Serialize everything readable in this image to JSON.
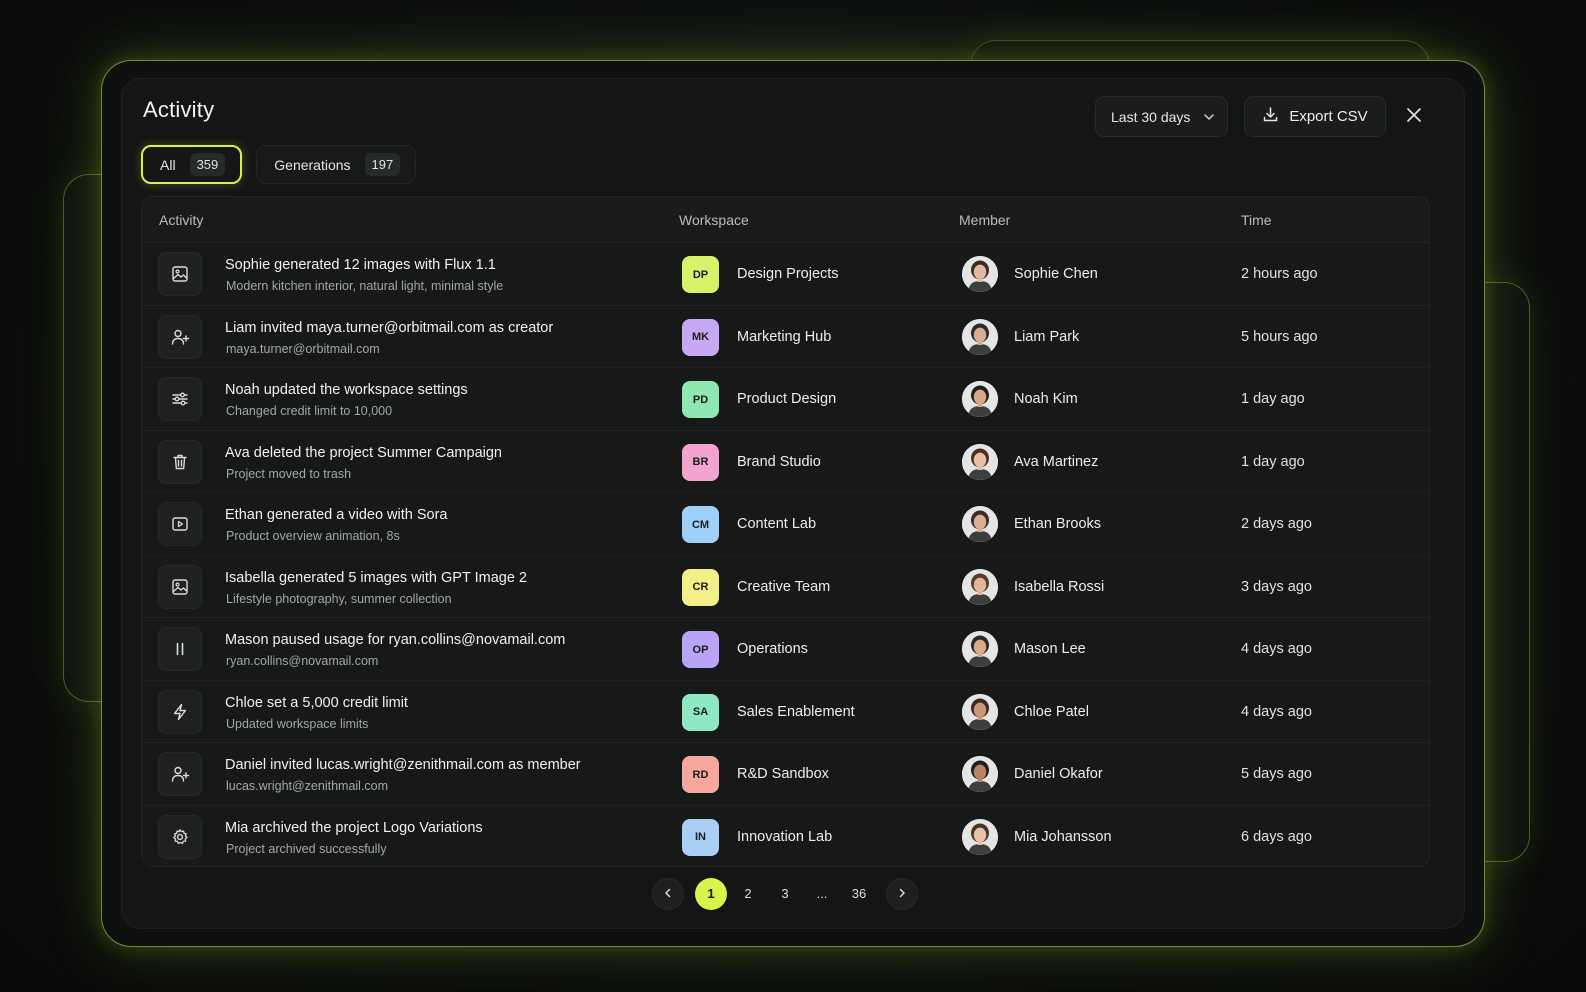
{
  "header": {
    "title": "Activity",
    "range_label": "Last 30 days",
    "export_label": "Export CSV"
  },
  "tabs": [
    {
      "label": "All",
      "count": "359",
      "active": true
    },
    {
      "label": "Generations",
      "count": "197",
      "active": false
    }
  ],
  "table": {
    "columns": [
      "Activity",
      "Workspace",
      "Member",
      "Time"
    ],
    "rows": [
      {
        "icon": "image-icon",
        "title": "Sophie generated 12 images with Flux 1.1",
        "subtitle": "Modern kitchen interior, natural light, minimal style",
        "ws_code": "DP",
        "ws_name": "Design Projects",
        "ws_color": "#d8f26a",
        "member": "Sophie Chen",
        "time": "2 hours ago"
      },
      {
        "icon": "user-plus-icon",
        "title": "Liam invited maya.turner@orbitmail.com as creator",
        "subtitle": "maya.turner@orbitmail.com",
        "ws_code": "MK",
        "ws_name": "Marketing Hub",
        "ws_color": "#c7a8f5",
        "member": "Liam Park",
        "time": "5 hours ago"
      },
      {
        "icon": "sliders-icon",
        "title": "Noah updated the workspace settings",
        "subtitle": "Changed credit limit to 10,000",
        "ws_code": "PD",
        "ws_name": "Product Design",
        "ws_color": "#8fe8b1",
        "member": "Noah Kim",
        "time": "1 day ago"
      },
      {
        "icon": "trash-icon",
        "title": "Ava deleted the project Summer Campaign",
        "subtitle": "Project moved to trash",
        "ws_code": "BR",
        "ws_name": "Brand Studio",
        "ws_color": "#f2a3cf",
        "member": "Ava Martinez",
        "time": "1 day ago"
      },
      {
        "icon": "video-icon",
        "title": "Ethan generated a video with Sora",
        "subtitle": "Product overview animation, 8s",
        "ws_code": "CM",
        "ws_name": "Content Lab",
        "ws_color": "#9fd0f7",
        "member": "Ethan Brooks",
        "time": "2 days ago"
      },
      {
        "icon": "image-icon",
        "title": "Isabella generated 5 images with GPT Image 2",
        "subtitle": "Lifestyle photography, summer collection",
        "ws_code": "CR",
        "ws_name": "Creative Team",
        "ws_color": "#f3f08a",
        "member": "Isabella Rossi",
        "time": "3 days ago"
      },
      {
        "icon": "pause-icon",
        "title": "Mason paused usage for ryan.collins@novamail.com",
        "subtitle": "ryan.collins@novamail.com",
        "ws_code": "OP",
        "ws_name": "Operations",
        "ws_color": "#b9a4f6",
        "member": "Mason Lee",
        "time": "4 days ago"
      },
      {
        "icon": "bolt-icon",
        "title": "Chloe set a 5,000 credit limit",
        "subtitle": "Updated workspace limits",
        "ws_code": "SA",
        "ws_name": "Sales Enablement",
        "ws_color": "#8fe8c4",
        "member": "Chloe Patel",
        "time": "4 days ago"
      },
      {
        "icon": "user-plus-icon",
        "title": "Daniel invited lucas.wright@zenithmail.com as member",
        "subtitle": "lucas.wright@zenithmail.com",
        "ws_code": "RD",
        "ws_name": "R&D Sandbox",
        "ws_color": "#f5a79b",
        "member": "Daniel Okafor",
        "time": "5 days ago"
      },
      {
        "icon": "gear-icon",
        "title": "Mia archived the project Logo Variations",
        "subtitle": "Project archived successfully",
        "ws_code": "IN",
        "ws_name": "Innovation Lab",
        "ws_color": "#a9cff6",
        "member": "Mia Johansson",
        "time": "6 days ago"
      }
    ]
  },
  "pagination": {
    "pages": [
      "1",
      "2",
      "3",
      "...",
      "36"
    ],
    "current": "1"
  },
  "colors": {
    "accent": "#d9f24c",
    "panel": "#141615",
    "border_glow": "#c8f046"
  }
}
